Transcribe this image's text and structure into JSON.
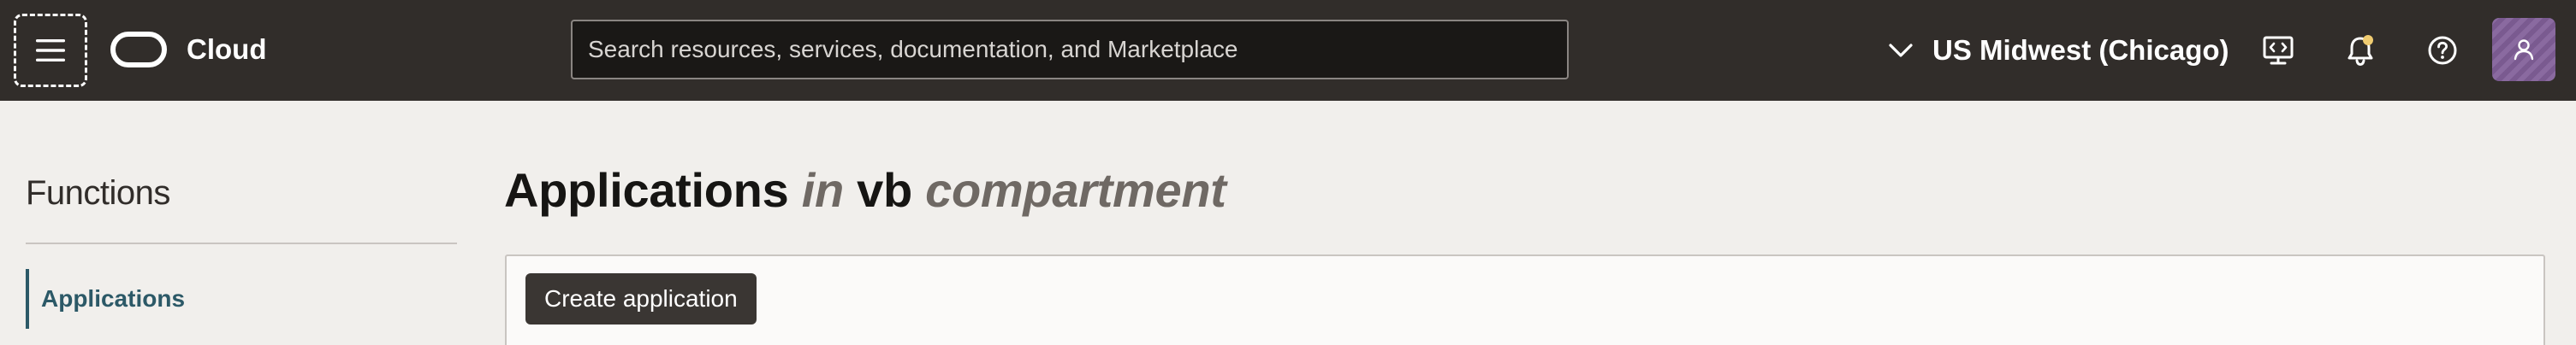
{
  "header": {
    "brand": "Cloud",
    "search": {
      "placeholder": "Search resources, services, documentation, and Marketplace",
      "value": ""
    },
    "region": {
      "label": "US Midwest (Chicago)"
    },
    "icons": [
      "hamburger-menu-icon",
      "oracle-logo-icon",
      "chevron-down-icon",
      "code-editor-icon",
      "bell-icon",
      "help-icon",
      "user-icon"
    ],
    "notification_dot_color": "#f0cc71"
  },
  "sidebar": {
    "title": "Functions",
    "items": [
      {
        "label": "Applications",
        "active": true
      }
    ]
  },
  "main": {
    "title": {
      "prefix": "Applications",
      "in": "in",
      "compartment_name": "vb",
      "suffix": "compartment"
    },
    "toolbar": {
      "create_label": "Create application"
    }
  },
  "colors": {
    "header_bg": "#312d2a",
    "page_bg": "#f1efec",
    "accent": "#2c5967",
    "button_bg": "#3a3633"
  }
}
